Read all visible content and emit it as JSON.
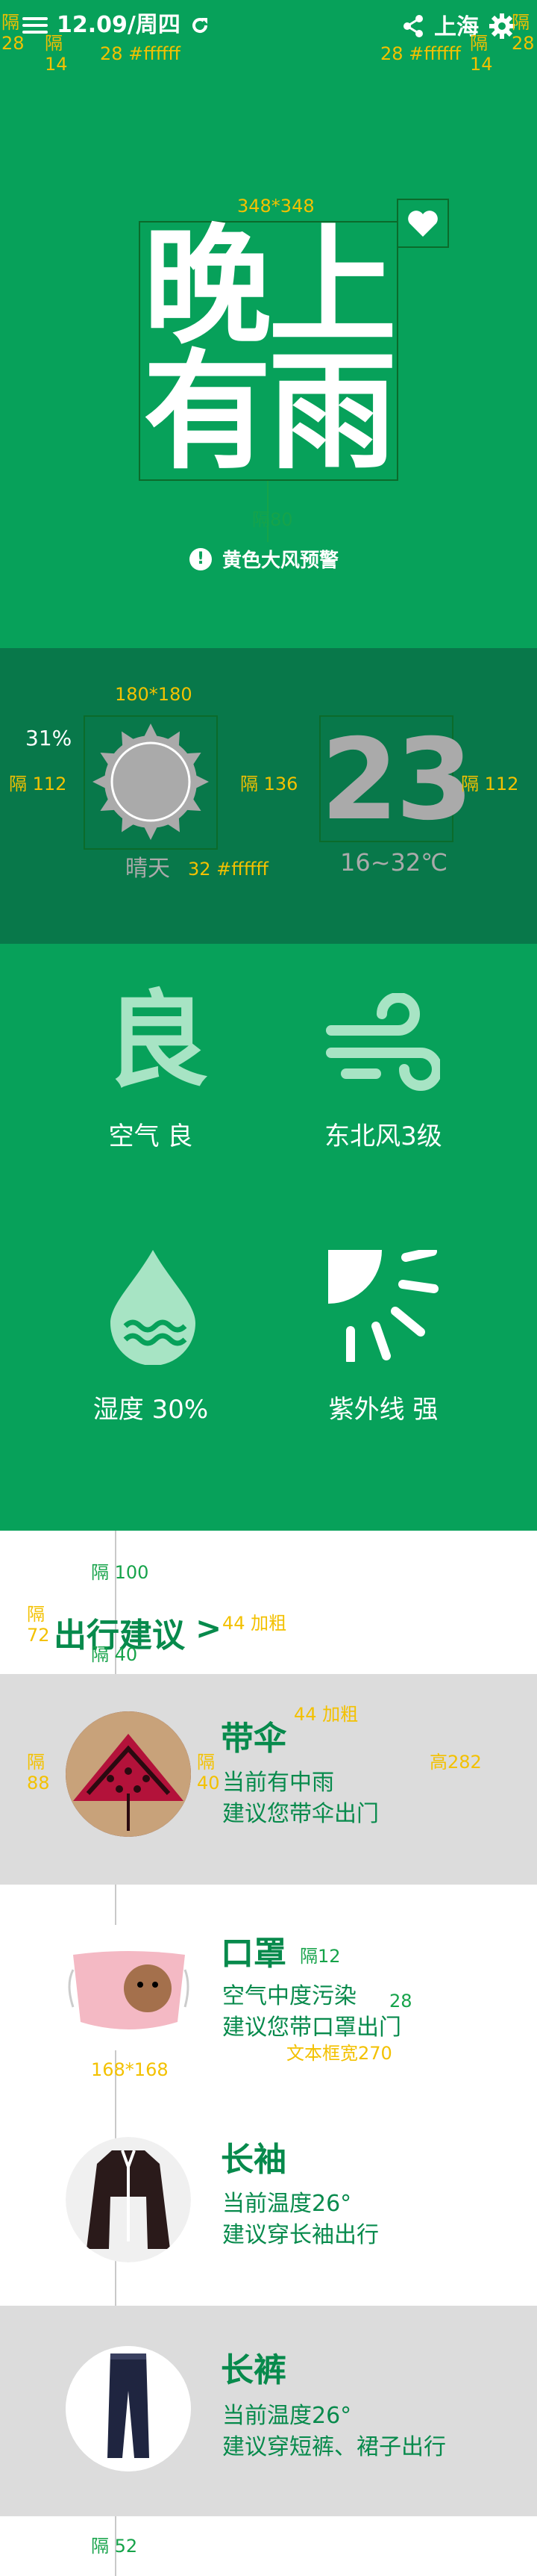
{
  "colors": {
    "primary": "#07a15a",
    "dark": "#08784a",
    "accent": "#f3c100",
    "text_green": "#078a4c",
    "gray_card": "#dcdcdc"
  },
  "topbar": {
    "date": "12.09/周四",
    "city": "上海",
    "menu_icon": "menu-icon",
    "refresh_icon": "refresh-icon",
    "share_icon": "share-icon",
    "settings_icon": "gear-icon"
  },
  "annotations": {
    "left_gap": "隔",
    "left_gap_num": "28",
    "top_gap": "隔",
    "top_gap_num": "14",
    "font_spec": "28 #ffffff",
    "right_gap": "隔",
    "right_gap_num": "28",
    "hero_size": "348*348",
    "gap80": "隔80",
    "sun_size": "180*180",
    "gap112": "隔 112",
    "gap136": "隔 136",
    "gap112b": "隔 112",
    "cond_spec": "32 #ffffff",
    "gap100": "隔 100",
    "gap72": "隔",
    "gap72_num": "72",
    "title_spec": "44 加粗",
    "gap40": "隔 40",
    "card_title_spec": "44 加粗",
    "gap88": "隔",
    "gap88_num": "88",
    "gap40b": "隔",
    "gap40b_num": "40",
    "height282": "高282",
    "gap12": "隔12",
    "num28": "28",
    "textbox": "文本框宽270",
    "img_size": "168*168",
    "gap52": "隔 52"
  },
  "hero": {
    "line1": "晚上",
    "line2": "有雨",
    "heart_icon": "heart-icon",
    "warning_icon": "exclamation-icon",
    "warning": "黄色大风预警"
  },
  "weather": {
    "humidity": "31%",
    "temperature": "23",
    "condition": "晴天",
    "range": "16~32℃",
    "sun_icon": "sun-icon"
  },
  "details": [
    {
      "icon": "air-quality-icon",
      "glyph": "良",
      "label": "空气 良"
    },
    {
      "icon": "wind-icon",
      "label": "东北风3级"
    },
    {
      "icon": "water-drop-icon",
      "label": "湿度 30%"
    },
    {
      "icon": "uv-sun-icon",
      "label": "紫外线 强"
    }
  ],
  "suggestions": {
    "title": "出行建议",
    "arrow": ">",
    "items": [
      {
        "title": "带伞",
        "line1": "当前有中雨",
        "line2": "建议您带伞出门",
        "image": "umbrella-image"
      },
      {
        "title": "口罩",
        "line1": "空气中度污染",
        "line2": "建议您带口罩出门",
        "image": "mask-image"
      },
      {
        "title": "长袖",
        "line1": "当前温度26°",
        "line2": "建议穿长袖出行",
        "image": "long-sleeve-image"
      },
      {
        "title": "长裤",
        "line1": "当前温度26°",
        "line2": "建议穿短裤、裙子出行",
        "image": "trousers-image"
      }
    ]
  }
}
